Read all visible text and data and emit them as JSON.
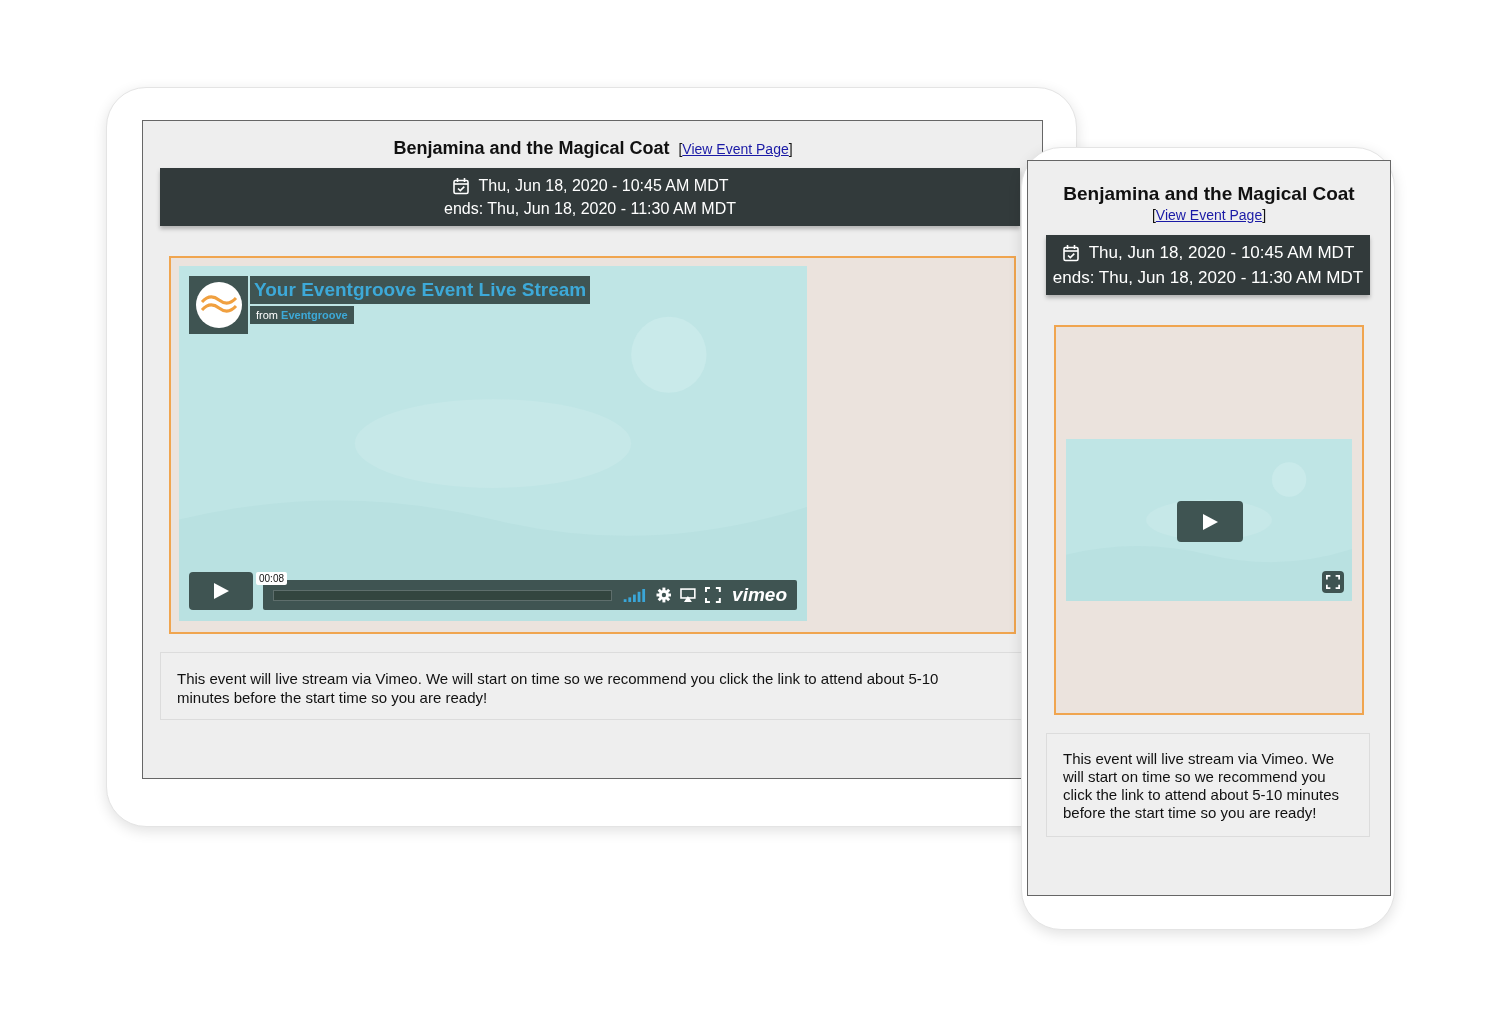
{
  "views": [
    {
      "kind": "tablet",
      "title": "Benjamina and the Magical Coat",
      "link_open": "[",
      "link": "View Event Page",
      "link_close": "]",
      "start": "Thu, Jun 18, 2020 - 10:45 AM MDT",
      "end": "ends: Thu, Jun 18, 2020 - 11:30 AM MDT",
      "player": {
        "kind": "full",
        "video_title": "Your Eventgroove Event Live Stream",
        "byline_prefix": "from",
        "byline_author": "Eventgroove",
        "time": "00:08",
        "brand": "vimeo"
      },
      "description": "This event will live stream via Vimeo. We will start on time so we recommend you click the link to attend about 5-10 minutes before the start time so you are ready!"
    },
    {
      "kind": "phone",
      "title": "Benjamina and the Magical Coat",
      "link_open": "[",
      "link": "View Event Page",
      "link_close": "]",
      "start": "Thu, Jun 18, 2020 - 10:45 AM MDT",
      "end": "ends: Thu, Jun 18, 2020 - 11:30 AM MDT",
      "player": {
        "kind": "compact"
      },
      "description": "This event will live stream via Vimeo. We will start on time so we recommend you click the link to attend about 5-10 minutes before the start time so you are ready!"
    }
  ]
}
